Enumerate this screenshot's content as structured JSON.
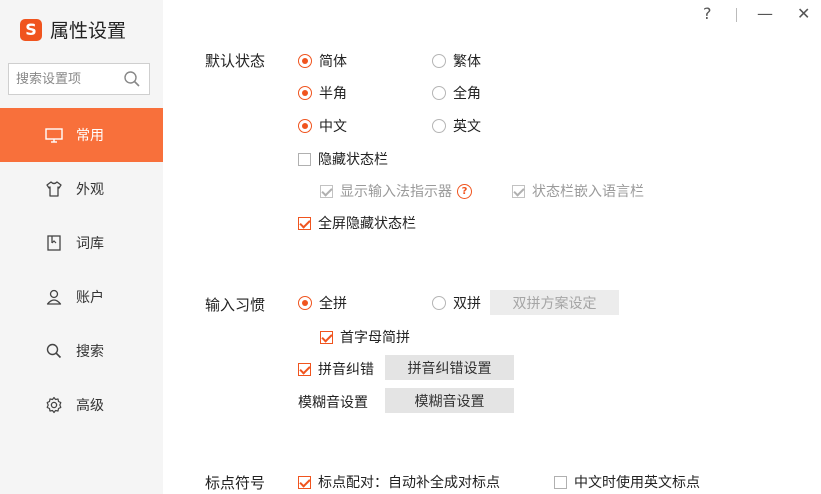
{
  "app": {
    "logo_letter": "S",
    "title": "属性设置"
  },
  "search": {
    "placeholder": "搜索设置项"
  },
  "window_controls": {
    "help": "?",
    "minimize": "—",
    "close": "✕"
  },
  "sidebar": {
    "items": [
      {
        "label": "常用",
        "icon": "monitor-icon",
        "active": true
      },
      {
        "label": "外观",
        "icon": "shirt-icon",
        "active": false
      },
      {
        "label": "词库",
        "icon": "book-icon",
        "active": false
      },
      {
        "label": "账户",
        "icon": "user-icon",
        "active": false
      },
      {
        "label": "搜索",
        "icon": "search-icon",
        "active": false
      },
      {
        "label": "高级",
        "icon": "gear-icon",
        "active": false
      }
    ]
  },
  "default_state": {
    "title": "默认状态",
    "simplified": "简体",
    "traditional": "繁体",
    "halfwidth": "半角",
    "fullwidth": "全角",
    "chinese": "中文",
    "english": "英文",
    "hide_status_bar": "隐藏状态栏",
    "show_indicator": "显示输入法指示器",
    "embed_language_bar": "状态栏嵌入语言栏",
    "fullscreen_hide": "全屏隐藏状态栏"
  },
  "input_habit": {
    "title": "输入习惯",
    "full_pinyin": "全拼",
    "double_pinyin": "双拼",
    "double_pinyin_settings": "双拼方案设定",
    "initial_abbrev": "首字母简拼",
    "pinyin_correction": "拼音纠错",
    "pinyin_correction_settings": "拼音纠错设置",
    "fuzzy_label": "模糊音设置",
    "fuzzy_button": "模糊音设置"
  },
  "punctuation": {
    "title": "标点符号",
    "auto_pair": "标点配对：自动补全成对标点",
    "english_punct_in_chinese": "中文时使用英文标点"
  },
  "colors": {
    "accent": "#f8703b",
    "check": "#f0541e",
    "sidebar_bg": "#f5f5f5"
  }
}
